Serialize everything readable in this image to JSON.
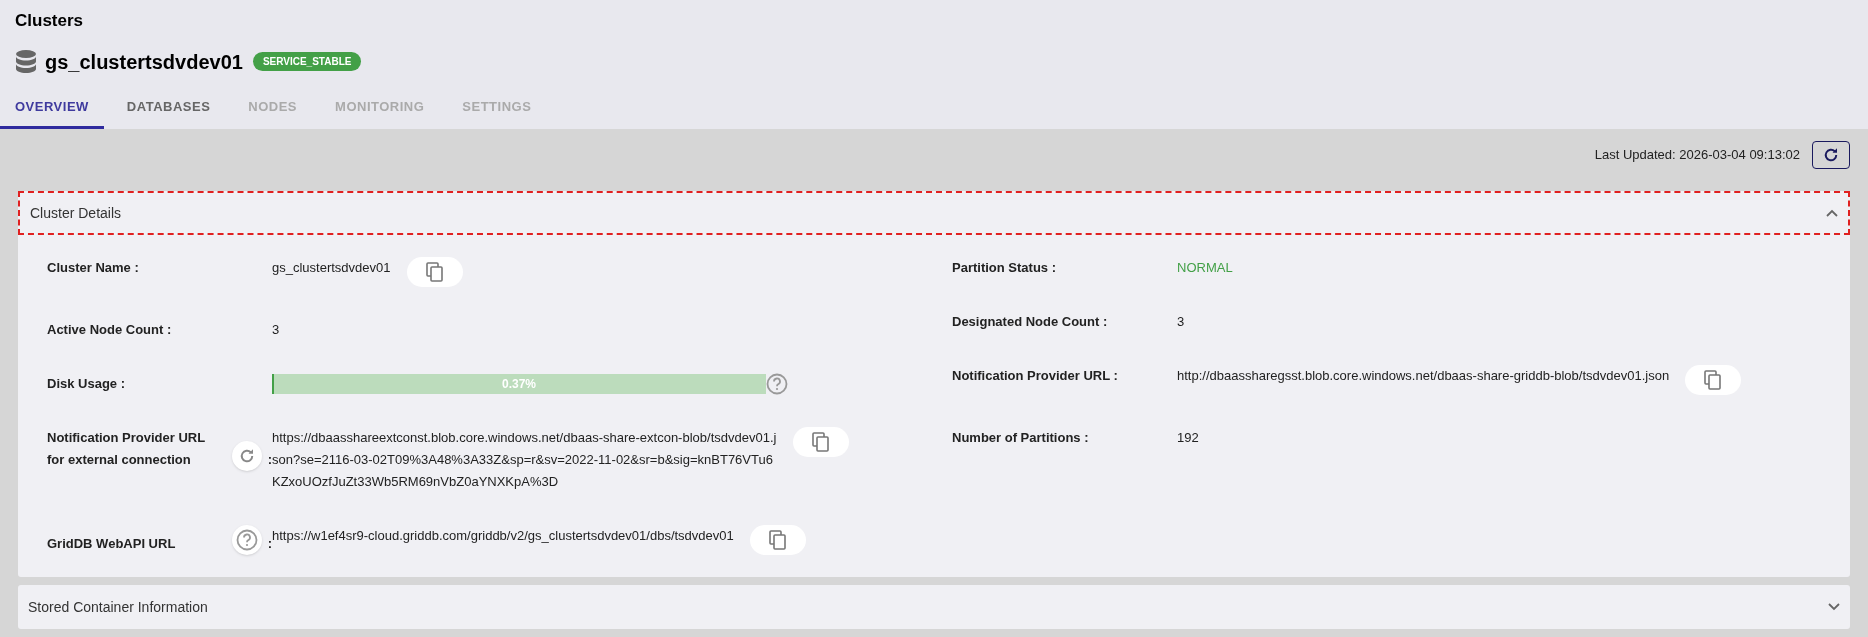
{
  "page_title": "Clusters",
  "cluster": {
    "name": "gs_clustertsdvdev01",
    "status_badge": "SERVICE_STABLE"
  },
  "tabs": [
    {
      "label": "OVERVIEW",
      "selected": true,
      "disabled": false
    },
    {
      "label": "DATABASES",
      "selected": false,
      "disabled": false
    },
    {
      "label": "NODES",
      "selected": false,
      "disabled": true
    },
    {
      "label": "MONITORING",
      "selected": false,
      "disabled": true
    },
    {
      "label": "SETTINGS",
      "selected": false,
      "disabled": true
    }
  ],
  "last_updated": "Last Updated: 2026-03-04 09:13:02",
  "panels": [
    {
      "title": "Cluster Details",
      "expanded": true,
      "left": [
        {
          "kind": "text",
          "label": "Cluster Name :",
          "value": "gs_clustertsdvdev01",
          "copyable": true
        },
        {
          "kind": "text",
          "label": "Active Node Count :",
          "value": "3",
          "copyable": false
        },
        {
          "kind": "progress",
          "label": "Disk Usage :",
          "value": "0.37%",
          "level": 0.0037
        },
        {
          "kind": "text",
          "label": "Notification Provider URL for external connection",
          "label_button": {
            "kind": "refresh"
          },
          "label_suffix": ":",
          "value": "https://dbaasshareextconst.blob.core.windows.net/dbaas-share-extcon-blob/tsdvdev01.json?se=2116-03-02T09%3A48%3A33Z&sp=r&sv=2022-11-02&sr=b&sig=knBT76VTu6KZxoUOzfJuZt33Wb5RM69nVbZ0aYNXKpA%3D",
          "copyable": true
        },
        {
          "kind": "text",
          "label": "GridDB WebAPI URL",
          "label_button": {
            "kind": "help"
          },
          "label_suffix": ":",
          "value": "https://w1ef4sr9-cloud.griddb.com/griddb/v2/gs_clustertsdvdev01/dbs/tsdvdev01",
          "copyable": true
        }
      ],
      "right": [
        {
          "kind": "status",
          "label": "Partition Status :",
          "value": "NORMAL",
          "copyable": false
        },
        {
          "kind": "text",
          "label": "Designated Node Count :",
          "value": "3",
          "copyable": false
        },
        {
          "kind": "text",
          "label": "Notification Provider URL :",
          "value": "http://dbaassharegsst.blob.core.windows.net/dbaas-share-griddb-blob/tsdvdev01.json",
          "copyable": true
        },
        {
          "kind": "text",
          "label": "Number of Partitions :",
          "value": "192",
          "copyable": false
        }
      ]
    },
    {
      "title": "Stored Container Information",
      "expanded": false
    }
  ]
}
